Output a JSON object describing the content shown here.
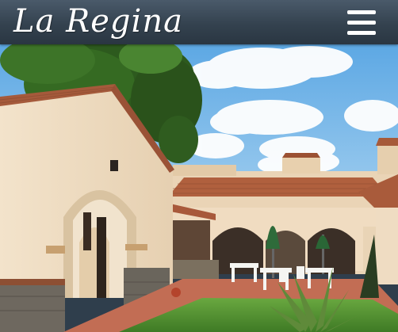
{
  "header": {
    "logo_text": "La Regina",
    "menu_icon": "hamburger-menu-icon"
  },
  "hero": {
    "scene": "hotel-courtyard-photo"
  },
  "colors": {
    "header_bg": "#34424f",
    "logo_text": "#ffffff",
    "sky": "#7fbbe6",
    "wall": "#efdcc2",
    "roof": "#a8593b",
    "grass": "#5d9a3a"
  }
}
